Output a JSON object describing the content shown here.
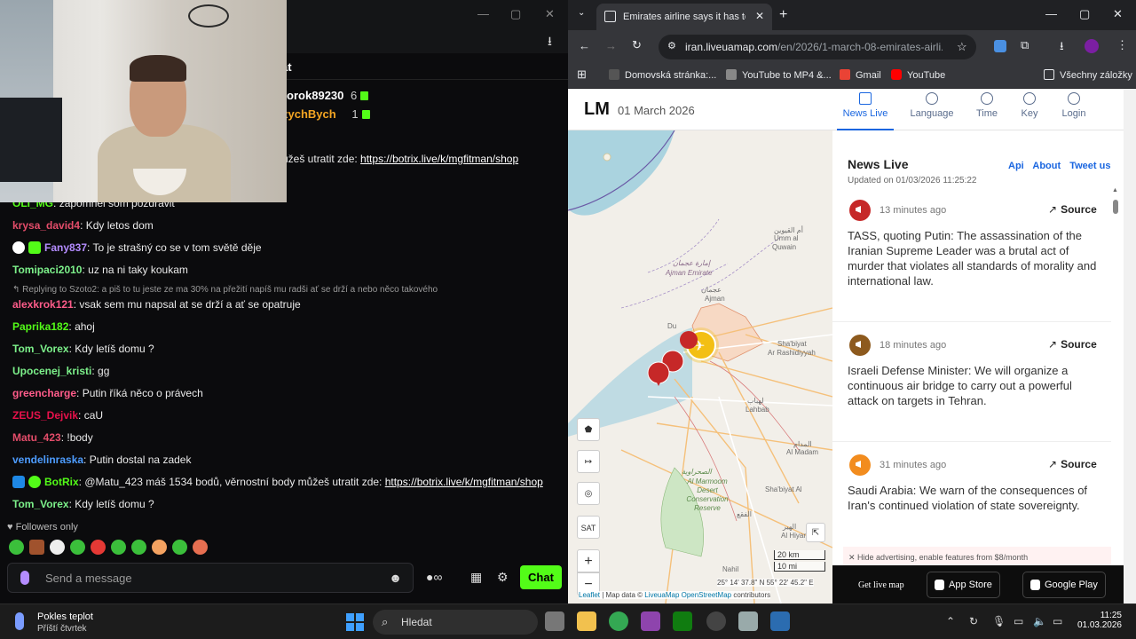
{
  "chat": {
    "header_title": "at",
    "leaders": [
      {
        "name": "rorok89230",
        "count": "6",
        "color": "#ffffff"
      },
      {
        "name": "zychBych",
        "count": "1",
        "color": "#f5a623"
      }
    ],
    "top_line": {
      "text": "ůžeš utratit zde: ",
      "link": "https://botrix.live/k/mgfitman/shop"
    },
    "messages": [
      {
        "user": "OLI_MG",
        "color": "#53fc18",
        "text": "zapomnel som pozdravit"
      },
      {
        "user": "krysa_david4",
        "color": "#e44d6a",
        "text": "Kdy letos dom"
      },
      {
        "user": "Fany837",
        "color": "#b48cff",
        "text": "To je strašný co se v tom světě děje"
      },
      {
        "user": "Tomipaci2010",
        "color": "#7cf08a",
        "text": "uz na ni taky koukam"
      },
      {
        "reply": "Replying to Szoto2: a piš to tu jeste ze ma 30% na přežití napíš mu radši ať se drží a nebo něco takového"
      },
      {
        "user": "alexkrok121",
        "color": "#ff5c8a",
        "text": "vsak sem mu napsal at se drží a ať se opatruje"
      },
      {
        "user": "Paprika182",
        "color": "#53fc18",
        "text": "ahoj"
      },
      {
        "user": "Tom_Vorex",
        "color": "#7cf08a",
        "text": "Kdy letíš domu ?"
      },
      {
        "user": "Upocenej_kristi",
        "color": "#7cf08a",
        "text": "gg"
      },
      {
        "user": "greencharge",
        "color": "#ff5c8a",
        "text": "Putin říká něco o právech"
      },
      {
        "user": "ZEUS_Dejvik",
        "color": "#e8114b",
        "text": "caU"
      },
      {
        "user": "Matu_423",
        "color": "#e44d6a",
        "text": "!body"
      },
      {
        "user": "vendelinraska",
        "color": "#4d9cff",
        "text": "Putin dostal na zadek"
      },
      {
        "user": "BotRix",
        "color": "#53fc18",
        "text": "@Matu_423 máš 1534 bodů, věrnostní body můžeš utratit zde: ",
        "link": "https://botrix.live/k/mgfitman/shop"
      },
      {
        "user": "Tom_Vorex",
        "color": "#7cf08a",
        "text": "Kdy letíš domu ?"
      }
    ],
    "followers_only": "Followers only",
    "input_placeholder": "Send a message",
    "chat_button": "Chat",
    "accent": "#53fc18"
  },
  "browser": {
    "tab_title": "Emirates airline says it has temp",
    "url_host": "iran.liveuamap.com",
    "url_path": "/en/2026/1-march-08-emirates-airli...",
    "bookmarks": [
      "Domovská stránka:...",
      "YouTube to MP4 &...",
      "Gmail",
      "YouTube"
    ],
    "all_bookmarks": "Všechny záložky"
  },
  "site": {
    "logo": "LM",
    "date": "01 March 2026",
    "nav": [
      "News Live",
      "Language",
      "Time",
      "Key",
      "Login"
    ],
    "feed_title": "News Live",
    "feed_links": [
      "Api",
      "About",
      "Tweet us"
    ],
    "updated": "Updated on 01/03/2026 11:25:22",
    "source_label": "Source",
    "items": [
      {
        "ago": "13 minutes ago",
        "text": "TASS, quoting Putin: The assassination of the Iranian Supreme Leader was a brutal act of murder that violates all standards of morality and international law.",
        "color": "#c62828"
      },
      {
        "ago": "18 minutes ago",
        "text": "Israeli Defense Minister: We will organize a continuous air bridge to carry out a powerful attack on targets in Tehran.",
        "color": "#8d5a1e"
      },
      {
        "ago": "31 minutes ago",
        "text": "Saudi Arabia: We warn of the consequences of Iran's continued violation of state sovereignty.",
        "color": "#f28c1e"
      }
    ],
    "ad_text": "✕ Hide advertising, enable features from $8/month",
    "get_app": "Get live map",
    "app_store": "App Store",
    "google_play": "Google Play"
  },
  "map": {
    "labels": {
      "umm": "Umm al",
      "quwain": "Quwain",
      "umm_ar": "أم القيوين",
      "ajman_ar": "إمارة عجمان",
      "ajman": "Ajman Emirate",
      "ajman_city": "Ajman",
      "ajman_city_ar": "عجمان",
      "dubai": "Du",
      "shabiyat": "Sha'biyat",
      "rashidiyyah": "Ar Rashidiyyah",
      "lahbab": "Lahbab",
      "lahbab_ar": "لهباب",
      "madam": "Al Madam",
      "madam_ar": "المدام",
      "desert_ar": "الصحراوية",
      "desert": "Al Marmoom Desert Conservation Reserve",
      "ar1": "الفقع",
      "ar2": "الهير",
      "hiyar": "Al Hiyar",
      "nahil": "Nahil",
      "shabiya2": "Sha'biyat Al"
    },
    "controls": {
      "sat": "SAT",
      "zoom_in": "+",
      "zoom_out": "−"
    },
    "scale_km": "20 km",
    "scale_mi": "10 mi",
    "coords": "25° 14' 37.8\" N 55° 22' 45.2\" E",
    "attribution_leaflet": "Leaflet",
    "attribution_text": " | Map data © ",
    "attribution_link": "LiveuaMap OpenStreetMap",
    "attribution_end": " contributors"
  },
  "taskbar": {
    "weather_title": "Pokles teplot",
    "weather_sub": "Příští čtvrtek",
    "search": "Hledat",
    "time": "11:25",
    "date": "01.03.2026"
  }
}
